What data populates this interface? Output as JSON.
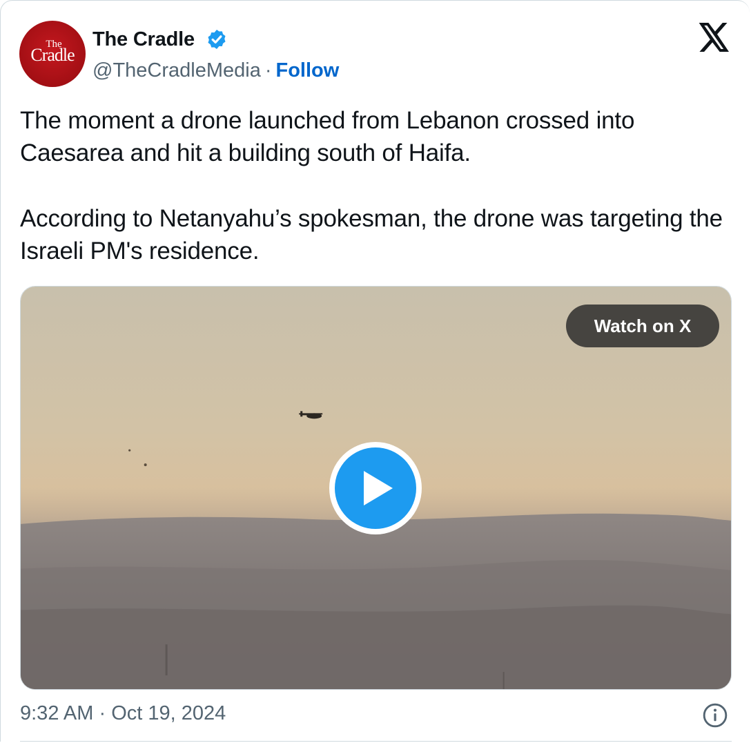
{
  "author": {
    "name": "The Cradle",
    "handle": "@TheCradleMedia",
    "separator": "·",
    "follow_label": "Follow",
    "avatar_logo_line1": "The",
    "avatar_logo_line2": "Cradle",
    "verified": true
  },
  "tweet": {
    "paragraphs": [
      "The moment a drone launched from Lebanon crossed into Caesarea and hit a building south of Haifa.",
      "According to Netanyahu’s spokesman, the drone was targeting the Israeli PM's residence."
    ]
  },
  "media": {
    "watch_label": "Watch on X",
    "play_icon": "play-icon"
  },
  "footer": {
    "time": "9:32 AM",
    "separator": "·",
    "date": "Oct 19, 2024",
    "info_icon": "info-icon"
  },
  "colors": {
    "link": "#0066cc",
    "verified": "#1d9bf0",
    "play": "#1d9bf0",
    "muted_text": "#536471",
    "avatar_red": "#b5141b"
  }
}
